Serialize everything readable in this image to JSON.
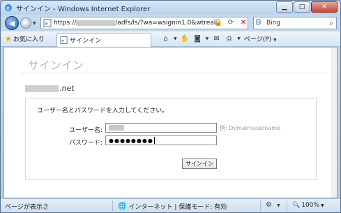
{
  "window": {
    "title": "サインイン - Windows Internet Explorer",
    "buttons": {
      "minimize": "▁",
      "maximize": "□",
      "close": "✕"
    }
  },
  "nav": {
    "back_icon": "back-arrow-icon",
    "forward_icon": "forward-arrow-icon",
    "address_prefix": "https://",
    "address_suffix": "/adfs/ls/?wa=wsignin1.0&wtrealr",
    "search_provider": "Bing"
  },
  "favorites": {
    "label": "お気に入り",
    "tab_label": "サインイン",
    "page_menu": "ページ(P)"
  },
  "page": {
    "title": "サインイン",
    "domain_suffix": ".net",
    "instruction": "ユーザー名とパスワードを入力してください。",
    "username_label": "ユーザー名:",
    "password_label": "パスワード:",
    "password_mask": "●●●●●●●●",
    "example_hint": "例: Domain\\username",
    "submit_label": "サインイン"
  },
  "status": {
    "left_text": "ページが表示さ",
    "zone_text": "インターネット | 保護モード: 有効",
    "zoom": "100%"
  }
}
